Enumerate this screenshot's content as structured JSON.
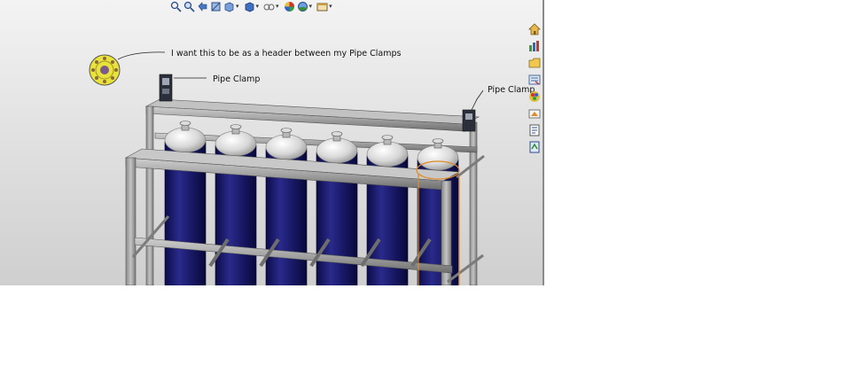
{
  "annotations": {
    "header_note": "I want this to be as a header between my Pipe Clamps",
    "clamp_left": "Pipe Clamp",
    "clamp_right": "Pipe Clamp"
  },
  "view_toolbar": {
    "buttons": [
      "zoom-to-fit-icon",
      "zoom-to-area-icon",
      "previous-view-icon",
      "section-view-icon",
      "view-orientation-icon",
      "display-style-icon",
      "hide-show-items-icon",
      "edit-appearance-icon",
      "apply-scene-icon",
      "view-settings-icon"
    ]
  },
  "task_pane": {
    "buttons": [
      "home-icon",
      "resources-icon",
      "design-library-icon",
      "file-explorer-icon",
      "view-palette-icon",
      "appearances-icon",
      "custom-properties-icon",
      "document-recovery-icon"
    ]
  },
  "colors": {
    "cylinder_body": "#1a1a6e",
    "frame": "#a9a9a9",
    "selection": "#e08a2a",
    "header_part": "#e9e23a"
  }
}
